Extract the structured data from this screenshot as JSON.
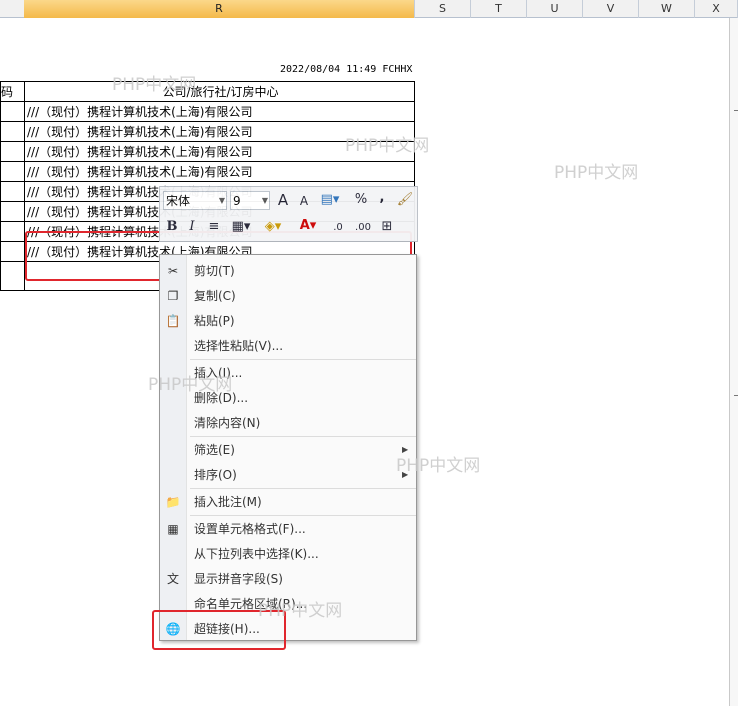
{
  "columns": [
    {
      "label": "R",
      "selected": true
    },
    {
      "label": "S",
      "selected": false
    },
    {
      "label": "T",
      "selected": false
    },
    {
      "label": "U",
      "selected": false
    },
    {
      "label": "V",
      "selected": false
    },
    {
      "label": "W",
      "selected": false
    },
    {
      "label": "X",
      "selected": false
    }
  ],
  "timestamp": "2022/08/04 11:49 FCHHX",
  "table": {
    "header_left": "码",
    "header_right": "公司/旅行社/订房中心",
    "rows": [
      "///（现付）携程计算机技术(上海)有限公司",
      "///（现付）携程计算机技术(上海)有限公司",
      "///（现付）携程计算机技术(上海)有限公司",
      "///（现付）携程计算机技术(上海)有限公司",
      "///（现付）携程计算机技术(上海)有限公司",
      "///（现付）携程计算机技术(上海)有限公司",
      "///（现付）携程计算机技术(上海)有限公司",
      "///（现付）携程计算机技术(上海)有限公司"
    ]
  },
  "watermark_text": "PHP中文网",
  "mini_toolbar": {
    "font_name": "宋体",
    "font_size": "9",
    "grow_font": "A",
    "shrink_font": "A",
    "percent": "%",
    "comma": ",",
    "bold": "B",
    "italic": "I",
    "font_color": "A",
    "inc_decimal": ".0",
    "dec_decimal": ".00"
  },
  "context_menu": {
    "items": [
      {
        "label": "剪切(T)",
        "icon": "scissors-icon",
        "glyph": "✂",
        "submenu": false
      },
      {
        "label": "复制(C)",
        "icon": "copy-icon",
        "glyph": "❐",
        "submenu": false
      },
      {
        "label": "粘贴(P)",
        "icon": "paste-icon",
        "glyph": "📋",
        "submenu": false
      },
      {
        "label": "选择性粘贴(V)...",
        "icon": "",
        "glyph": "",
        "submenu": false
      },
      {
        "label": "插入(I)...",
        "icon": "",
        "glyph": "",
        "submenu": false
      },
      {
        "label": "删除(D)...",
        "icon": "",
        "glyph": "",
        "submenu": false
      },
      {
        "label": "清除内容(N)",
        "icon": "",
        "glyph": "",
        "submenu": false
      },
      {
        "label": "筛选(E)",
        "icon": "",
        "glyph": "",
        "submenu": true
      },
      {
        "label": "排序(O)",
        "icon": "",
        "glyph": "",
        "submenu": true
      },
      {
        "label": "插入批注(M)",
        "icon": "comment-icon",
        "glyph": "📁",
        "submenu": false
      },
      {
        "label": "设置单元格格式(F)...",
        "icon": "format-cells-icon",
        "glyph": "▦",
        "submenu": false
      },
      {
        "label": "从下拉列表中选择(K)...",
        "icon": "",
        "glyph": "",
        "submenu": false
      },
      {
        "label": "显示拼音字段(S)",
        "icon": "phonetic-icon",
        "glyph": "文",
        "submenu": false
      },
      {
        "label": "命名单元格区域(R)...",
        "icon": "",
        "glyph": "",
        "submenu": false
      },
      {
        "label": "超链接(H)...",
        "icon": "hyperlink-icon",
        "glyph": "🌐",
        "submenu": false
      }
    ]
  },
  "colors": {
    "highlight_red": "#e0262d",
    "selected_column": "#f4b94a"
  }
}
